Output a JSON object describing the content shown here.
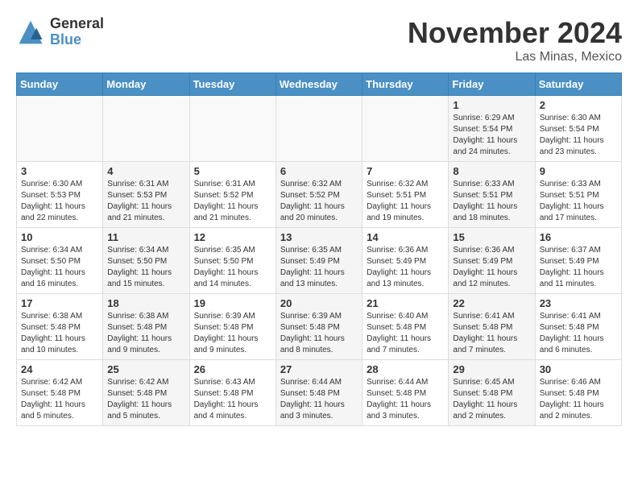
{
  "header": {
    "logo_general": "General",
    "logo_blue": "Blue",
    "month_title": "November 2024",
    "location": "Las Minas, Mexico"
  },
  "days_of_week": [
    "Sunday",
    "Monday",
    "Tuesday",
    "Wednesday",
    "Thursday",
    "Friday",
    "Saturday"
  ],
  "weeks": [
    [
      {
        "day": "",
        "info": ""
      },
      {
        "day": "",
        "info": ""
      },
      {
        "day": "",
        "info": ""
      },
      {
        "day": "",
        "info": ""
      },
      {
        "day": "",
        "info": ""
      },
      {
        "day": "1",
        "info": "Sunrise: 6:29 AM\nSunset: 5:54 PM\nDaylight: 11 hours and 24 minutes."
      },
      {
        "day": "2",
        "info": "Sunrise: 6:30 AM\nSunset: 5:54 PM\nDaylight: 11 hours and 23 minutes."
      }
    ],
    [
      {
        "day": "3",
        "info": "Sunrise: 6:30 AM\nSunset: 5:53 PM\nDaylight: 11 hours and 22 minutes."
      },
      {
        "day": "4",
        "info": "Sunrise: 6:31 AM\nSunset: 5:53 PM\nDaylight: 11 hours and 21 minutes."
      },
      {
        "day": "5",
        "info": "Sunrise: 6:31 AM\nSunset: 5:52 PM\nDaylight: 11 hours and 21 minutes."
      },
      {
        "day": "6",
        "info": "Sunrise: 6:32 AM\nSunset: 5:52 PM\nDaylight: 11 hours and 20 minutes."
      },
      {
        "day": "7",
        "info": "Sunrise: 6:32 AM\nSunset: 5:51 PM\nDaylight: 11 hours and 19 minutes."
      },
      {
        "day": "8",
        "info": "Sunrise: 6:33 AM\nSunset: 5:51 PM\nDaylight: 11 hours and 18 minutes."
      },
      {
        "day": "9",
        "info": "Sunrise: 6:33 AM\nSunset: 5:51 PM\nDaylight: 11 hours and 17 minutes."
      }
    ],
    [
      {
        "day": "10",
        "info": "Sunrise: 6:34 AM\nSunset: 5:50 PM\nDaylight: 11 hours and 16 minutes."
      },
      {
        "day": "11",
        "info": "Sunrise: 6:34 AM\nSunset: 5:50 PM\nDaylight: 11 hours and 15 minutes."
      },
      {
        "day": "12",
        "info": "Sunrise: 6:35 AM\nSunset: 5:50 PM\nDaylight: 11 hours and 14 minutes."
      },
      {
        "day": "13",
        "info": "Sunrise: 6:35 AM\nSunset: 5:49 PM\nDaylight: 11 hours and 13 minutes."
      },
      {
        "day": "14",
        "info": "Sunrise: 6:36 AM\nSunset: 5:49 PM\nDaylight: 11 hours and 13 minutes."
      },
      {
        "day": "15",
        "info": "Sunrise: 6:36 AM\nSunset: 5:49 PM\nDaylight: 11 hours and 12 minutes."
      },
      {
        "day": "16",
        "info": "Sunrise: 6:37 AM\nSunset: 5:49 PM\nDaylight: 11 hours and 11 minutes."
      }
    ],
    [
      {
        "day": "17",
        "info": "Sunrise: 6:38 AM\nSunset: 5:48 PM\nDaylight: 11 hours and 10 minutes."
      },
      {
        "day": "18",
        "info": "Sunrise: 6:38 AM\nSunset: 5:48 PM\nDaylight: 11 hours and 9 minutes."
      },
      {
        "day": "19",
        "info": "Sunrise: 6:39 AM\nSunset: 5:48 PM\nDaylight: 11 hours and 9 minutes."
      },
      {
        "day": "20",
        "info": "Sunrise: 6:39 AM\nSunset: 5:48 PM\nDaylight: 11 hours and 8 minutes."
      },
      {
        "day": "21",
        "info": "Sunrise: 6:40 AM\nSunset: 5:48 PM\nDaylight: 11 hours and 7 minutes."
      },
      {
        "day": "22",
        "info": "Sunrise: 6:41 AM\nSunset: 5:48 PM\nDaylight: 11 hours and 7 minutes."
      },
      {
        "day": "23",
        "info": "Sunrise: 6:41 AM\nSunset: 5:48 PM\nDaylight: 11 hours and 6 minutes."
      }
    ],
    [
      {
        "day": "24",
        "info": "Sunrise: 6:42 AM\nSunset: 5:48 PM\nDaylight: 11 hours and 5 minutes."
      },
      {
        "day": "25",
        "info": "Sunrise: 6:42 AM\nSunset: 5:48 PM\nDaylight: 11 hours and 5 minutes."
      },
      {
        "day": "26",
        "info": "Sunrise: 6:43 AM\nSunset: 5:48 PM\nDaylight: 11 hours and 4 minutes."
      },
      {
        "day": "27",
        "info": "Sunrise: 6:44 AM\nSunset: 5:48 PM\nDaylight: 11 hours and 3 minutes."
      },
      {
        "day": "28",
        "info": "Sunrise: 6:44 AM\nSunset: 5:48 PM\nDaylight: 11 hours and 3 minutes."
      },
      {
        "day": "29",
        "info": "Sunrise: 6:45 AM\nSunset: 5:48 PM\nDaylight: 11 hours and 2 minutes."
      },
      {
        "day": "30",
        "info": "Sunrise: 6:46 AM\nSunset: 5:48 PM\nDaylight: 11 hours and 2 minutes."
      }
    ]
  ]
}
